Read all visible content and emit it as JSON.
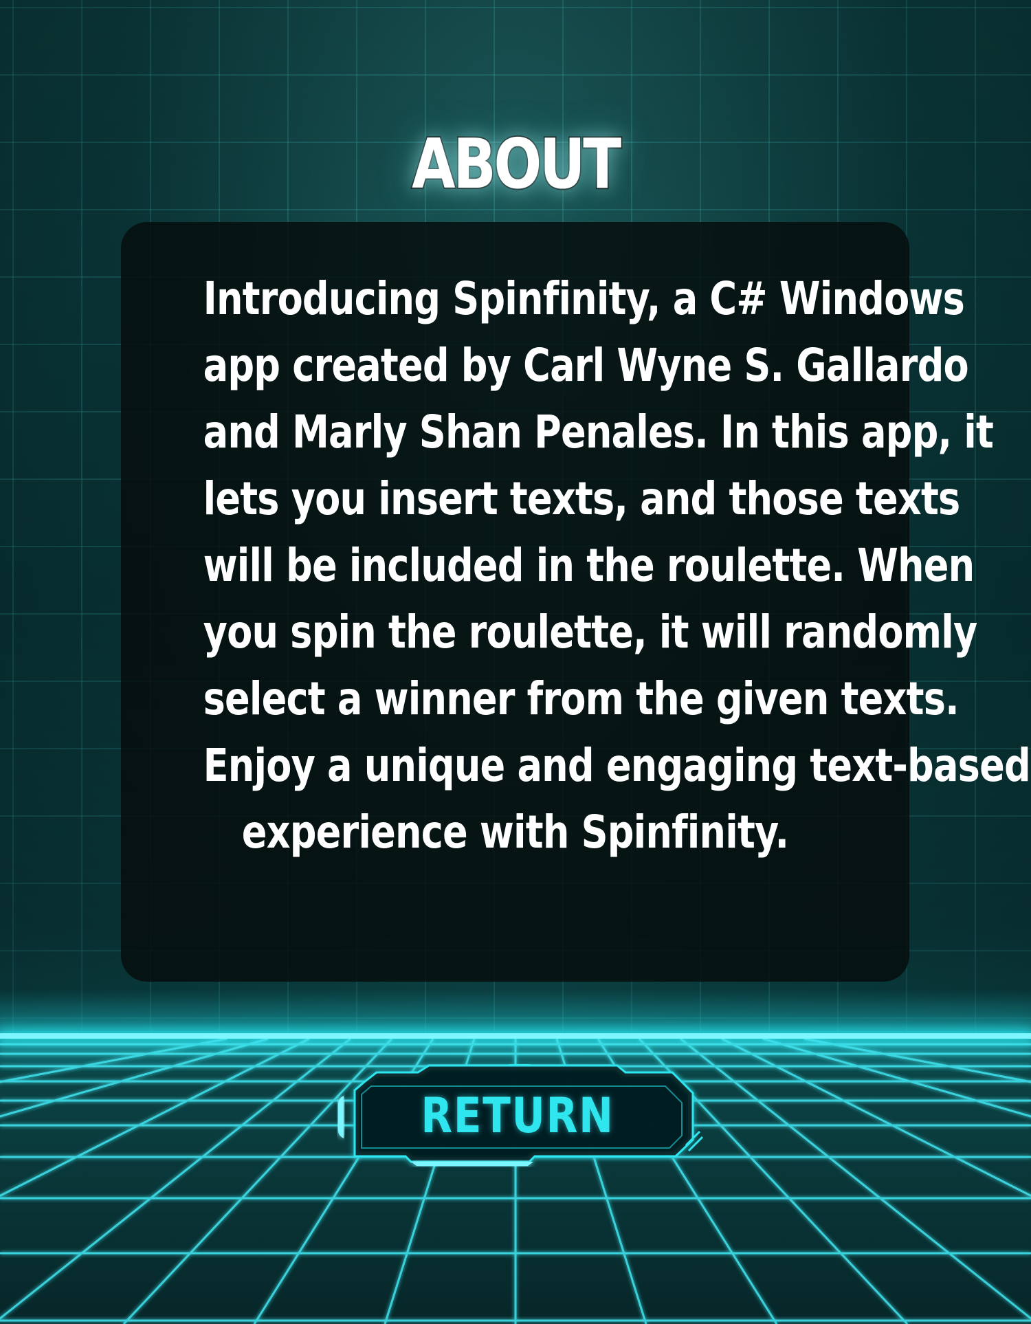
{
  "header": {
    "title": "ABOUT"
  },
  "about": {
    "lines": [
      "Introducing Spinfinity, a C# Windows",
      "app created by Carl Wyne S. Gallardo",
      "and Marly Shan Penales. In this app, it",
      "lets you insert texts, and those texts",
      "will be included in the roulette. When",
      "you spin the roulette, it will randomly",
      "select a winner from the given texts.",
      "Enjoy a unique and engaging text-based",
      "experience with Spinfinity."
    ]
  },
  "actions": {
    "return_label": "RETURN"
  },
  "colors": {
    "accent": "#2fe6ef",
    "grid_glow": "#7ff6ff",
    "panel": "#060e0e",
    "background": "#083234"
  },
  "icons": {
    "return_frame": "tech-frame-icon"
  }
}
